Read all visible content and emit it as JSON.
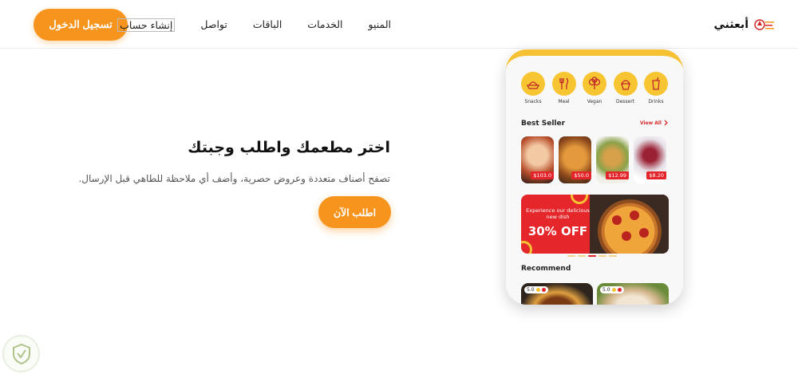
{
  "header": {
    "login_label": "تسجيل الدخول",
    "nav": [
      "المنيو",
      "الخدمات",
      "الباقات",
      "تواصل",
      "إنشاء حساب"
    ],
    "brand_name": "أبعثني"
  },
  "hero": {
    "title": "اختر مطعمك واطلب وجبتك",
    "description": "تصفح أصناف متعددة وعروض حصرية، وأضف أي ملاحظة للطاهي قبل الإرسال.",
    "order_label": "اطلب الآن"
  },
  "phone": {
    "categories": [
      {
        "label": "Snacks",
        "icon": "snacks-icon"
      },
      {
        "label": "Meal",
        "icon": "meal-icon"
      },
      {
        "label": "Vegan",
        "icon": "vegan-icon"
      },
      {
        "label": "Dessert",
        "icon": "dessert-icon"
      },
      {
        "label": "Drinks",
        "icon": "drinks-icon"
      }
    ],
    "best_seller_title": "Best Seller",
    "view_all_label": "View All",
    "best_sellers": [
      {
        "price": "$103.0",
        "color": "#b8502d"
      },
      {
        "price": "$50.0",
        "color": "#c47a2c"
      },
      {
        "price": "$12.99",
        "color": "#8aa24a"
      },
      {
        "price": "$8.20",
        "color": "#e6e0e6"
      }
    ],
    "banner": {
      "text": "Experience our delicious new dish",
      "offer": "30% OFF"
    },
    "recommend_title": "Recommend",
    "recommendations": [
      {
        "rating": "5.0",
        "color": "#b86a2a"
      },
      {
        "rating": "5.0",
        "color": "#d2b48a"
      }
    ]
  },
  "colors": {
    "accent": "#f7941d",
    "yellow": "#f6c233",
    "red": "#e3242b"
  }
}
